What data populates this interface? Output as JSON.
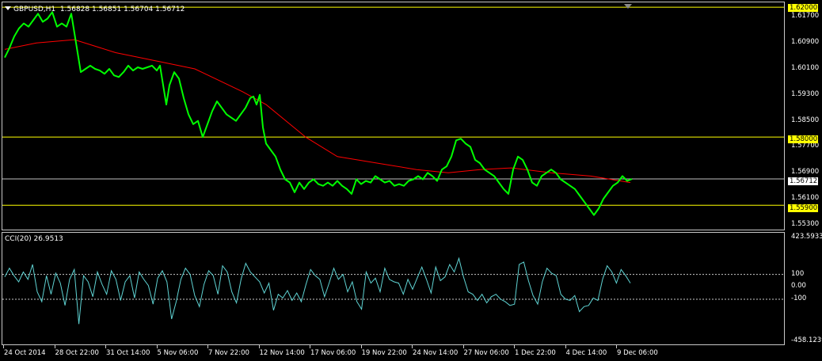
{
  "symbol": {
    "name": "GBPUSD,H1",
    "prices": "1.56828 1.56851 1.56704 1.56712"
  },
  "colors": {
    "background": "#000000",
    "price_line": "#00ff00",
    "moving_average": "#ff0000",
    "level_line": "#ffff00",
    "current_price_line": "#c0c0c0",
    "cci_line": "#5fd3d3",
    "badge": "#ffff00"
  },
  "price_axis": {
    "ticks": [
      "1.61700",
      "1.60900",
      "1.60100",
      "1.59300",
      "1.58500",
      "1.57700",
      "1.56900",
      "1.56100",
      "1.55300"
    ],
    "badges": {
      "top_level": "1.62000",
      "upper_level": "1.58000",
      "current": "1.56712",
      "lower_level": "1.55900"
    }
  },
  "indicator": {
    "label": "CCI(20) 26.9513",
    "axis": {
      "max": "423.5933",
      "plus100": "100",
      "zero": "0.00",
      "minus100": "-100",
      "min": "-458.1239"
    }
  },
  "time_axis": {
    "labels": [
      "24 Oct 2014",
      "28 Oct 22:00",
      "31 Oct 14:00",
      "5 Nov 06:00",
      "7 Nov 22:00",
      "12 Nov 14:00",
      "17 Nov 06:00",
      "19 Nov 22:00",
      "24 Nov 14:00",
      "27 Nov 06:00",
      "1 Dec 22:00",
      "4 Dec 14:00",
      "9 Dec 06:00"
    ]
  },
  "chart_data": {
    "type": "line",
    "series": [
      {
        "name": "GBPUSD,H1",
        "x": [
          0,
          6,
          12,
          18,
          24,
          30,
          36,
          42,
          48,
          54,
          60,
          66,
          72,
          78,
          84,
          88,
          92,
          96,
          102,
          108,
          114,
          120,
          126,
          132,
          138,
          144,
          150,
          156,
          162,
          168,
          174,
          180,
          186,
          192,
          196,
          200,
          204,
          208,
          214,
          220,
          226,
          232,
          238,
          244,
          250,
          256,
          262,
          268,
          274,
          280,
          286,
          292,
          298,
          304,
          310,
          314,
          318,
          322,
          326,
          330,
          336,
          342,
          348,
          354,
          360,
          366,
          372,
          378,
          384,
          390,
          396,
          402,
          408,
          414,
          420,
          426,
          432,
          438,
          444,
          450,
          456,
          462,
          468,
          474,
          480,
          486,
          492,
          498,
          504,
          510,
          516,
          522,
          528,
          534,
          540,
          546,
          552,
          558,
          564,
          570,
          576,
          582,
          588,
          594,
          600,
          606,
          612,
          618,
          624,
          630,
          636,
          642,
          648,
          654,
          660,
          666,
          672,
          678,
          684,
          690,
          696,
          702,
          708,
          714,
          720,
          726,
          732,
          738,
          744,
          750,
          756,
          762,
          768,
          774,
          780,
          786,
          792
        ],
        "values": [
          1.6045,
          1.6075,
          1.611,
          1.6135,
          1.615,
          1.614,
          1.616,
          1.618,
          1.6155,
          1.6165,
          1.6185,
          1.614,
          1.615,
          1.614,
          1.618,
          1.612,
          1.606,
          1.6,
          1.601,
          1.602,
          1.601,
          1.6005,
          1.5995,
          1.601,
          1.599,
          1.5985,
          1.6,
          1.602,
          1.6005,
          1.6015,
          1.601,
          1.6015,
          1.602,
          1.6005,
          1.602,
          1.596,
          1.59,
          1.596,
          1.6,
          1.598,
          1.592,
          1.587,
          1.584,
          1.585,
          1.58,
          1.584,
          1.588,
          1.591,
          1.589,
          1.587,
          1.586,
          1.585,
          1.587,
          1.589,
          1.592,
          1.5925,
          1.59,
          1.593,
          1.583,
          1.578,
          1.576,
          1.574,
          1.57,
          1.567,
          1.566,
          1.563,
          1.566,
          1.564,
          1.566,
          1.567,
          1.5655,
          1.565,
          1.566,
          1.565,
          1.5665,
          1.565,
          1.564,
          1.5625,
          1.567,
          1.5655,
          1.5665,
          1.566,
          1.568,
          1.567,
          1.566,
          1.5665,
          1.565,
          1.5655,
          1.565,
          1.5665,
          1.567,
          1.568,
          1.567,
          1.569,
          1.568,
          1.5665,
          1.57,
          1.571,
          1.574,
          1.579,
          1.5795,
          1.578,
          1.577,
          1.573,
          1.572,
          1.57,
          1.569,
          1.568,
          1.566,
          1.564,
          1.5625,
          1.57,
          1.574,
          1.573,
          1.57,
          1.566,
          1.565,
          1.568,
          1.569,
          1.57,
          1.569,
          1.567,
          1.566,
          1.565,
          1.564,
          1.562,
          1.56,
          1.558,
          1.556,
          1.558,
          1.561,
          1.563,
          1.565,
          1.566,
          1.568,
          1.5665,
          1.5671
        ]
      },
      {
        "name": "MA",
        "x": [
          0,
          40,
          88,
          140,
          200,
          240,
          300,
          330,
          380,
          420,
          470,
          520,
          560,
          600,
          640,
          690,
          740,
          790
        ],
        "values": [
          1.607,
          1.609,
          1.61,
          1.606,
          1.603,
          1.601,
          1.594,
          1.59,
          1.58,
          1.574,
          1.572,
          1.57,
          1.569,
          1.57,
          1.5705,
          1.569,
          1.568,
          1.566
        ]
      }
    ],
    "levels": [
      1.62,
      1.58,
      1.56712,
      1.559
    ],
    "ylim": [
      1.552,
      1.621
    ],
    "indicator": {
      "name": "CCI(20)",
      "ylim": [
        -458.1239,
        423.5933
      ],
      "levels": [
        100,
        0,
        -100
      ],
      "values": [
        80,
        150,
        90,
        40,
        120,
        60,
        180,
        -40,
        -120,
        90,
        -60,
        110,
        30,
        -150,
        60,
        140,
        -300,
        90,
        40,
        -80,
        120,
        20,
        -60,
        130,
        60,
        -110,
        40,
        90,
        -90,
        120,
        60,
        10,
        -140,
        70,
        130,
        40,
        -260,
        -120,
        60,
        150,
        100,
        -70,
        -160,
        20,
        130,
        90,
        -60,
        170,
        120,
        -40,
        -130,
        60,
        190,
        120,
        80,
        40,
        -50,
        30,
        -190,
        -60,
        -90,
        -30,
        -110,
        -50,
        -120,
        20,
        140,
        90,
        60,
        -80,
        30,
        150,
        60,
        100,
        -40,
        40,
        -120,
        -180,
        120,
        30,
        70,
        -40,
        150,
        60,
        40,
        30,
        -60,
        60,
        -20,
        70,
        160,
        60,
        -50,
        160,
        50,
        80,
        180,
        120,
        230,
        80,
        -40,
        -60,
        -110,
        -60,
        -130,
        -80,
        -60,
        -100,
        -120,
        -150,
        -140,
        180,
        200,
        50,
        -70,
        -140,
        40,
        150,
        110,
        90,
        -60,
        -100,
        -110,
        -70,
        -200,
        -160,
        -150,
        -90,
        -110,
        60,
        170,
        120,
        30,
        140,
        90,
        30
      ]
    }
  }
}
